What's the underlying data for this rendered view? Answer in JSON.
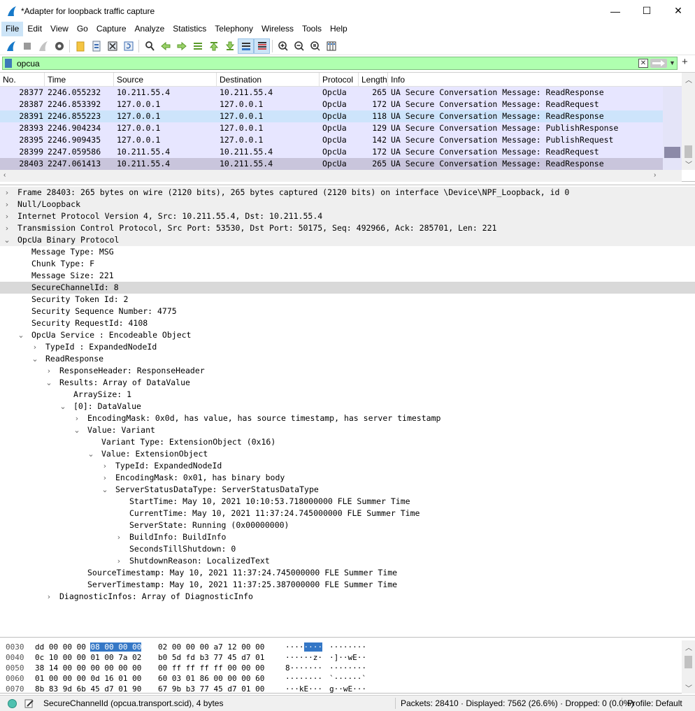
{
  "window": {
    "title": "*Adapter for loopback traffic capture",
    "minimize_glyph": "—",
    "maximize_glyph": "☐",
    "close_glyph": "✕"
  },
  "menu": [
    "File",
    "Edit",
    "View",
    "Go",
    "Capture",
    "Analyze",
    "Statistics",
    "Telephony",
    "Wireless",
    "Tools",
    "Help"
  ],
  "filter": {
    "value": "opcua",
    "clear_glyph": "✕",
    "dropdown_glyph": "▼",
    "add_glyph": "+"
  },
  "packet_list": {
    "headers": [
      "No.",
      "Time",
      "Source",
      "Destination",
      "Protocol",
      "Length",
      "Info"
    ],
    "rows": [
      {
        "no": "28377",
        "time": "2246.055232",
        "src": "10.211.55.4",
        "dst": "10.211.55.4",
        "proto": "OpcUa",
        "len": "265",
        "info": "UA Secure Conversation Message: ReadResponse"
      },
      {
        "no": "28387",
        "time": "2246.853392",
        "src": "127.0.0.1",
        "dst": "127.0.0.1",
        "proto": "OpcUa",
        "len": "172",
        "info": "UA Secure Conversation Message: ReadRequest"
      },
      {
        "no": "28391",
        "time": "2246.855223",
        "src": "127.0.0.1",
        "dst": "127.0.0.1",
        "proto": "OpcUa",
        "len": "118",
        "info": "UA Secure Conversation Message: ReadResponse"
      },
      {
        "no": "28393",
        "time": "2246.904234",
        "src": "127.0.0.1",
        "dst": "127.0.0.1",
        "proto": "OpcUa",
        "len": "129",
        "info": "UA Secure Conversation Message: PublishResponse"
      },
      {
        "no": "28395",
        "time": "2246.909435",
        "src": "127.0.0.1",
        "dst": "127.0.0.1",
        "proto": "OpcUa",
        "len": "142",
        "info": "UA Secure Conversation Message: PublishRequest"
      },
      {
        "no": "28399",
        "time": "2247.059586",
        "src": "10.211.55.4",
        "dst": "10.211.55.4",
        "proto": "OpcUa",
        "len": "172",
        "info": "UA Secure Conversation Message: ReadRequest"
      },
      {
        "no": "28403",
        "time": "2247.061413",
        "src": "10.211.55.4",
        "dst": "10.211.55.4",
        "proto": "OpcUa",
        "len": "265",
        "info": "UA Secure Conversation Message: ReadResponse"
      }
    ]
  },
  "details": [
    {
      "level": 0,
      "tw": "›",
      "text": "Frame 28403: 265 bytes on wire (2120 bits), 265 bytes captured (2120 bits) on interface \\Device\\NPF_Loopback, id 0",
      "cls": "hl"
    },
    {
      "level": 0,
      "tw": "›",
      "text": "Null/Loopback",
      "cls": "hl"
    },
    {
      "level": 0,
      "tw": "›",
      "text": "Internet Protocol Version 4, Src: 10.211.55.4, Dst: 10.211.55.4",
      "cls": "hl"
    },
    {
      "level": 0,
      "tw": "›",
      "text": "Transmission Control Protocol, Src Port: 53530, Dst Port: 50175, Seq: 492966, Ack: 285701, Len: 221",
      "cls": "hl"
    },
    {
      "level": 0,
      "tw": "⌄",
      "text": "OpcUa Binary Protocol",
      "cls": "hl"
    },
    {
      "level": 1,
      "tw": "",
      "text": "Message Type: MSG",
      "cls": ""
    },
    {
      "level": 1,
      "tw": "",
      "text": "Chunk Type: F",
      "cls": ""
    },
    {
      "level": 1,
      "tw": "",
      "text": "Message Size: 221",
      "cls": ""
    },
    {
      "level": 1,
      "tw": "",
      "text": "SecureChannelId: 8",
      "cls": "sel"
    },
    {
      "level": 1,
      "tw": "",
      "text": "Security Token Id: 2",
      "cls": ""
    },
    {
      "level": 1,
      "tw": "",
      "text": "Security Sequence Number: 4775",
      "cls": ""
    },
    {
      "level": 1,
      "tw": "",
      "text": "Security RequestId: 4108",
      "cls": ""
    },
    {
      "level": 1,
      "tw": "⌄",
      "text": "OpcUa Service : Encodeable Object",
      "cls": ""
    },
    {
      "level": 2,
      "tw": "›",
      "text": "TypeId : ExpandedNodeId",
      "cls": ""
    },
    {
      "level": 2,
      "tw": "⌄",
      "text": "ReadResponse",
      "cls": ""
    },
    {
      "level": 3,
      "tw": "›",
      "text": "ResponseHeader: ResponseHeader",
      "cls": ""
    },
    {
      "level": 3,
      "tw": "⌄",
      "text": "Results: Array of DataValue",
      "cls": ""
    },
    {
      "level": 4,
      "tw": "",
      "text": "ArraySize: 1",
      "cls": ""
    },
    {
      "level": 4,
      "tw": "⌄",
      "text": "[0]: DataValue",
      "cls": ""
    },
    {
      "level": 5,
      "tw": "›",
      "text": "EncodingMask: 0x0d, has value, has source timestamp, has server timestamp",
      "cls": ""
    },
    {
      "level": 5,
      "tw": "⌄",
      "text": "Value: Variant",
      "cls": ""
    },
    {
      "level": 6,
      "tw": "",
      "text": "Variant Type: ExtensionObject (0x16)",
      "cls": ""
    },
    {
      "level": 6,
      "tw": "⌄",
      "text": "Value: ExtensionObject",
      "cls": ""
    },
    {
      "level": 7,
      "tw": "›",
      "text": "TypeId: ExpandedNodeId",
      "cls": ""
    },
    {
      "level": 7,
      "tw": "›",
      "text": "EncodingMask: 0x01, has binary body",
      "cls": ""
    },
    {
      "level": 7,
      "tw": "⌄",
      "text": "ServerStatusDataType: ServerStatusDataType",
      "cls": ""
    },
    {
      "level": 8,
      "tw": "",
      "text": "StartTime: May 10, 2021 10:10:53.718000000 FLE Summer Time",
      "cls": ""
    },
    {
      "level": 8,
      "tw": "",
      "text": "CurrentTime: May 10, 2021 11:37:24.745000000 FLE Summer Time",
      "cls": ""
    },
    {
      "level": 8,
      "tw": "",
      "text": "ServerState: Running (0x00000000)",
      "cls": ""
    },
    {
      "level": 8,
      "tw": "›",
      "text": "BuildInfo: BuildInfo",
      "cls": ""
    },
    {
      "level": 8,
      "tw": "",
      "text": "SecondsTillShutdown: 0",
      "cls": ""
    },
    {
      "level": 8,
      "tw": "›",
      "text": "ShutdownReason: LocalizedText",
      "cls": ""
    },
    {
      "level": 5,
      "tw": "",
      "text": "SourceTimestamp: May 10, 2021 11:37:24.745000000 FLE Summer Time",
      "cls": ""
    },
    {
      "level": 5,
      "tw": "",
      "text": "ServerTimestamp: May 10, 2021 11:37:25.387000000 FLE Summer Time",
      "cls": ""
    },
    {
      "level": 3,
      "tw": "›",
      "text": "DiagnosticInfos: Array of DiagnosticInfo",
      "cls": ""
    }
  ],
  "bytes": [
    {
      "off": "0030",
      "hex1a": "dd 00 00 00 ",
      "hex1hl": "08 00 00 00",
      "hex1b": "",
      "hex2": "02 00 00 00 a7 12 00 00",
      "asc1a": "····",
      "asc1hl": "····",
      "asc2": "········"
    },
    {
      "off": "0040",
      "hex1a": "0c 10 00 00 01 00 7a 02",
      "hex1hl": "",
      "hex1b": "",
      "hex2": "b0 5d fd b3 77 45 d7 01",
      "asc1a": "······z·",
      "asc1hl": "",
      "asc2": "·]··wE··"
    },
    {
      "off": "0050",
      "hex1a": "38 14 00 00 00 00 00 00",
      "hex1hl": "",
      "hex1b": "",
      "hex2": "00 ff ff ff ff 00 00 00",
      "asc1a": "8·······",
      "asc1hl": "",
      "asc2": "········"
    },
    {
      "off": "0060",
      "hex1a": "01 00 00 00 0d 16 01 00",
      "hex1hl": "",
      "hex1b": "",
      "hex2": "60 03 01 86 00 00 00 60",
      "asc1a": "········",
      "asc1hl": "",
      "asc2": "`······`"
    },
    {
      "off": "0070",
      "hex1a": "8b 83 9d 6b 45 d7 01 90",
      "hex1hl": "",
      "hex1b": "",
      "hex2": "67 9b b3 77 45 d7 01 00",
      "asc1a": "···kE···",
      "asc1hl": "",
      "asc2": "g··wE···"
    }
  ],
  "status": {
    "field": "SecureChannelId (opcua.transport.scid), 4 bytes",
    "packets": "Packets: 28410 · Displayed: 7562 (26.6%) · Dropped: 0 (0.0%)",
    "profile": "Profile: Default"
  }
}
